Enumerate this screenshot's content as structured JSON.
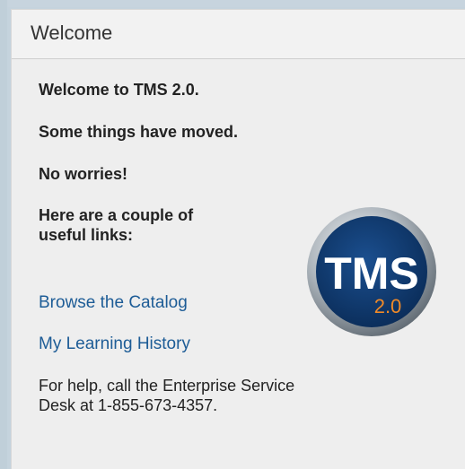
{
  "panel": {
    "title": "Welcome"
  },
  "content": {
    "line1": "Welcome to TMS 2.0.",
    "line2": "Some things have moved.",
    "line3": "No worries!",
    "line4": "Here are a couple of useful links:",
    "links": [
      {
        "label": "Browse the Catalog"
      },
      {
        "label": "My Learning History"
      }
    ],
    "help_text": "For help, call the Enterprise Service Desk at 1-855-673-4357."
  },
  "logo": {
    "main_text": "TMS",
    "version_text": "2.0",
    "colors": {
      "ring": "#9aa4ad",
      "disc": "#0f3c73",
      "version": "#f08a28"
    }
  },
  "colors": {
    "link": "#1d5c96",
    "panel_bg": "#eeeeee",
    "page_bg": "#c5d3dd"
  }
}
